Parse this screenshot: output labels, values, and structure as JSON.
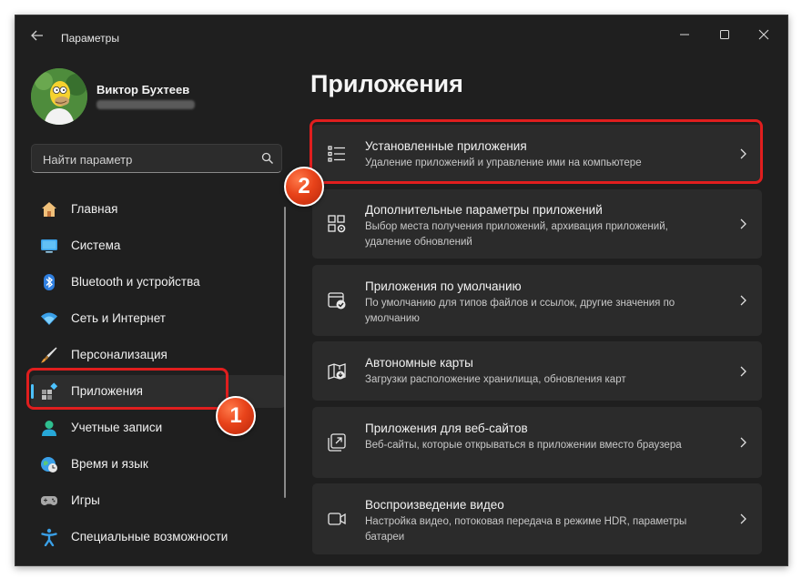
{
  "window": {
    "title": "Параметры",
    "back_icon": "arrow-left-icon",
    "controls": [
      "minimize-icon",
      "maximize-icon",
      "close-icon"
    ]
  },
  "user": {
    "name": "Виктор Бухтеев"
  },
  "search": {
    "placeholder": "Найти параметр",
    "icon": "search-icon"
  },
  "nav": {
    "items": [
      {
        "label": "Главная",
        "icon": "home-icon"
      },
      {
        "label": "Система",
        "icon": "display-icon"
      },
      {
        "label": "Bluetooth и устройства",
        "icon": "bluetooth-icon"
      },
      {
        "label": "Сеть и Интернет",
        "icon": "wifi-icon"
      },
      {
        "label": "Персонализация",
        "icon": "brush-icon"
      },
      {
        "label": "Приложения",
        "icon": "apps-icon",
        "active": true
      },
      {
        "label": "Учетные записи",
        "icon": "account-icon"
      },
      {
        "label": "Время и язык",
        "icon": "globe-clock-icon"
      },
      {
        "label": "Игры",
        "icon": "gamepad-icon"
      },
      {
        "label": "Специальные возможности",
        "icon": "accessibility-icon"
      }
    ]
  },
  "main": {
    "title": "Приложения",
    "cards": [
      {
        "title": "Установленные приложения",
        "desc": "Удаление приложений и управление ими на компьютере",
        "icon": "list-icon"
      },
      {
        "title": "Дополнительные параметры приложений",
        "desc": "Выбор места получения приложений, архивация приложений, удаление обновлений",
        "icon": "apps-settings-icon"
      },
      {
        "title": "Приложения по умолчанию",
        "desc": "По умолчанию для типов файлов и ссылок, другие значения по умолчанию",
        "icon": "default-apps-icon"
      },
      {
        "title": "Автономные карты",
        "desc": "Загрузки расположение хранилища, обновления карт",
        "icon": "map-icon"
      },
      {
        "title": "Приложения для веб-сайтов",
        "desc": "Веб-сайты, которые открываться в приложении вместо браузера",
        "icon": "open-external-icon"
      },
      {
        "title": "Воспроизведение видео",
        "desc": "Настройка видео, потоковая передача в режиме HDR, параметры батареи",
        "icon": "video-icon"
      }
    ]
  },
  "callouts": [
    {
      "number": "1"
    },
    {
      "number": "2"
    }
  ],
  "colors": {
    "accent": "#4cc2ff",
    "window_bg": "#1f1f1f",
    "card_bg": "#2b2b2b",
    "highlight": "#e01e1e",
    "badge": "#e8431a"
  }
}
